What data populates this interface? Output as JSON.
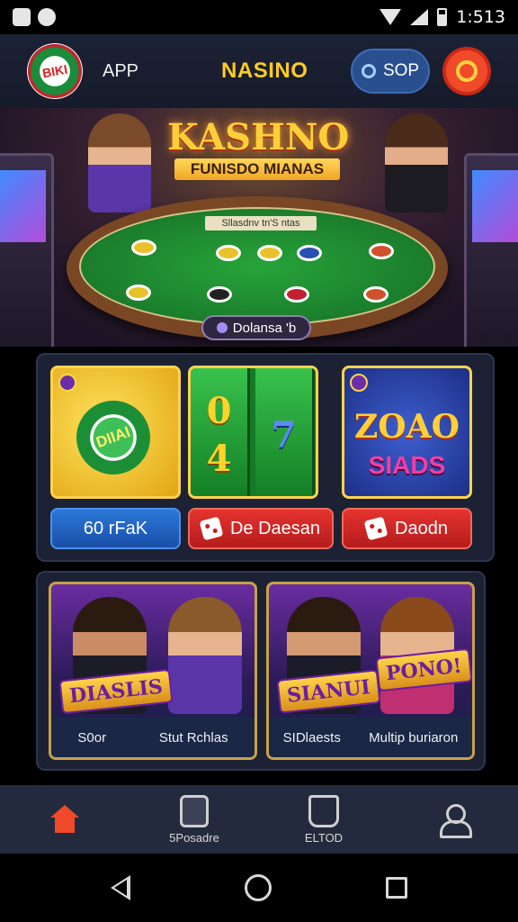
{
  "status_bar": {
    "time": "1:513"
  },
  "header": {
    "logo_text": "BIKI",
    "app_label": "APP",
    "brand": "NASINO",
    "coins_label": "SOP"
  },
  "hero": {
    "title": "KASHNO",
    "subtitle": "FUNISDO MIANAS",
    "table_strip": "Sllasdnv tn'S ntas",
    "pill_label": "Dolansa 'b"
  },
  "games_top": {
    "tile_gold_text": "DIIAI",
    "reel1": [
      "0",
      "4"
    ],
    "reel2": [
      "7"
    ],
    "tile_blue_big": "ZOAO",
    "tile_blue_sub": "SIADS",
    "buttons": [
      "60 rFaK",
      "De Daesan",
      "Daodn"
    ]
  },
  "games_bottom": {
    "card1_badge": "DIASLIS",
    "card1_captions": [
      "S0or",
      "Stut Rchlas"
    ],
    "card2_badge": "SIANUI",
    "card2_badge2": "PONO!",
    "card2_captions": [
      "SIDlaests",
      "Multip buriaron"
    ]
  },
  "bottom_nav": {
    "items": [
      {
        "label": "",
        "icon": "home-icon"
      },
      {
        "label": "5Posadre",
        "icon": "box-icon"
      },
      {
        "label": "ELTOD",
        "icon": "bin-icon"
      },
      {
        "label": "",
        "icon": "user-icon"
      }
    ]
  },
  "colors": {
    "accent_yellow": "#ffcc22",
    "accent_red": "#e4332f",
    "accent_blue": "#2b78d8",
    "felt_green": "#1b7d2c"
  }
}
